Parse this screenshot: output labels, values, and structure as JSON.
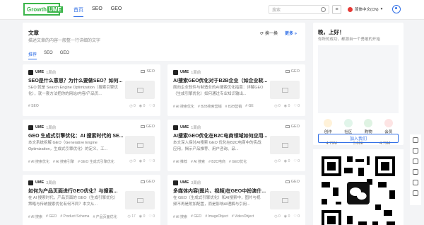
{
  "header": {
    "logo_text_a": "Growth",
    "logo_text_b": "UME",
    "nav": [
      {
        "label": "首页",
        "active": true
      },
      {
        "label": "SEO",
        "active": false
      },
      {
        "label": "GEO",
        "active": false
      }
    ],
    "search_placeholder": "搜索",
    "language": "简体中文(CN)",
    "language_chevron": "▾"
  },
  "main": {
    "title": "文章",
    "subtitle": "描述文章的内容一般整一行详细的文字",
    "refresh_label": "换一换",
    "more_label": "更多",
    "tabs": [
      {
        "label": "推荐",
        "active": true
      },
      {
        "label": "SEO",
        "active": false
      },
      {
        "label": "GEO",
        "active": false
      }
    ],
    "cards": [
      {
        "author": "UME",
        "ago": "1周前",
        "category": "SEO",
        "title": "SEO是什么意思？为什么要做SEO？如何...",
        "desc": "SEO 就是 Search Engine Optimization（搜索引擎优化），就一套方法把你的网站/内容/产品页...",
        "tags": [
          "SEO"
        ],
        "stats": [
          "0",
          "0",
          "0"
        ]
      },
      {
        "author": "UME",
        "ago": "1周前",
        "category": "GEO",
        "title": "AI搜索GEO优化对于B2B企业（如企业软...",
        "desc": "面向企业软件与制造业的AI搜索优化指南：详解GEO（生成引擎优化）如何通过专业知识输出...",
        "tags": [
          "AI 搜索优化",
          "B2B搜索营销",
          "B2B营销",
          "GE"
        ],
        "stats": [
          "0",
          "0",
          "0"
        ]
      },
      {
        "author": "UME",
        "ago": "1周前",
        "category": "GEO",
        "title": "GEO 生成式引擎优化：AI 搜索时代的 SE...",
        "desc": "本文系统拆解 GEO（Generative Engine Optimization，生成式引擎优化）的定义、工...",
        "tags": [
          "AI 搜索优化",
          "AI 搜索引擎",
          "GEO 生成式引擎优化"
        ],
        "stats": [
          "0",
          "0",
          "0"
        ]
      },
      {
        "author": "UME",
        "ago": "1周前",
        "category": "GEO",
        "title": "AI搜索GEO优化在B2C电商领域如何应用...",
        "desc": "本文深入探讨AI搜索 GEO 优化在B2C电商中的实战应用，揭示产品推荐、用户咨询、品...",
        "tags": [
          "AI 推荐",
          "AI 搜索",
          "B2C电商",
          "GEO优化"
        ],
        "stats": [
          "0",
          "0",
          "0"
        ]
      },
      {
        "author": "UME",
        "ago": "3周前",
        "category": "GEO",
        "title": "如何为产品页面进行GEO优化？与搜索...",
        "desc": "在 AI 搜索时代，产品页面的 GEO（生成引擎优化）策略与传统搜索优化有何不同？本文从...",
        "tags": [
          "AI 搜索",
          "GEO",
          "Product Schema",
          "产品页面优化"
        ],
        "stats": [
          "17",
          "0",
          "0"
        ]
      },
      {
        "author": "UME",
        "ago": "3周前",
        "category": "GEO",
        "title": "多媒体内容(图片、视频)在GEO中扮演什...",
        "desc": "在 GEO（生成式引擎优化）和AI搜索中，图片与视频不再是附加配置，而是影响AI理解与引用...",
        "tags": [
          "AI 搜索",
          "GEO",
          "ImageObject",
          "VideoObject"
        ],
        "stats": [
          "0",
          "0",
          "0"
        ]
      }
    ]
  },
  "sidebar": {
    "greeting": "晚，上好！",
    "greeting_sub": "你所的成功，都源自一个勇敢的开始",
    "quick": [
      {
        "label": "创作",
        "color": "#f5a623"
      },
      {
        "label": "社区",
        "color": "#7ed3a3"
      },
      {
        "label": "购物",
        "color": "#3bb54a"
      },
      {
        "label": "会员",
        "color": "#f27b7b"
      }
    ],
    "stats": [
      "4.79M",
      "3.88K",
      "4.79M"
    ],
    "join_label": "加入我们"
  },
  "colors": {
    "accent": "#2f6ee6",
    "brand": "#3bb54a"
  }
}
